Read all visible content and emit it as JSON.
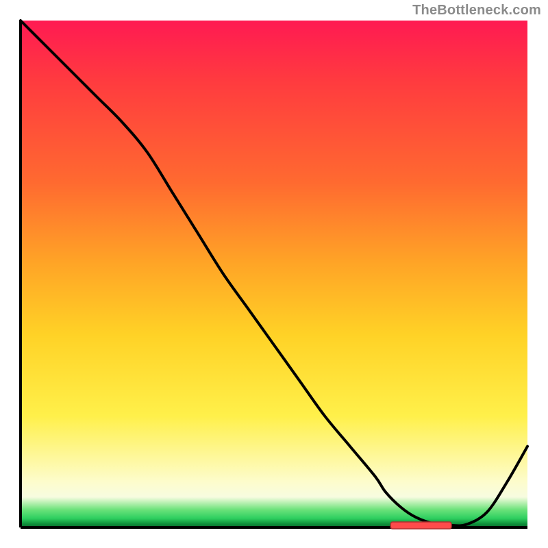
{
  "attribution": "TheBottleneck.com",
  "colors": {
    "gradient_top": "#ff1a52",
    "gradient_mid": "#ffd226",
    "gradient_green": "#2ecf60",
    "axis": "#000000",
    "curve": "#000000",
    "marker_fill": "#ff4b4b",
    "marker_stroke": "#b03030"
  },
  "chart_data": {
    "type": "line",
    "title": "",
    "xlabel": "",
    "ylabel": "",
    "xlim": [
      0,
      100
    ],
    "ylim": [
      0,
      100
    ],
    "grid": false,
    "legend": false,
    "series": [
      {
        "name": "curve",
        "x": [
          0,
          5,
          10,
          15,
          20,
          25,
          30,
          35,
          40,
          45,
          50,
          55,
          60,
          65,
          70,
          72,
          75,
          78,
          82,
          85,
          88,
          92,
          96,
          100
        ],
        "values": [
          100,
          95,
          90,
          85,
          80,
          74,
          66,
          58,
          50,
          43,
          36,
          29,
          22,
          16,
          10,
          7,
          4,
          2,
          0.6,
          0.4,
          0.6,
          3,
          9,
          16
        ]
      }
    ],
    "annotations": [
      {
        "name": "optimum-marker",
        "x_start": 73,
        "x_end": 85,
        "y": 0.4
      }
    ]
  }
}
